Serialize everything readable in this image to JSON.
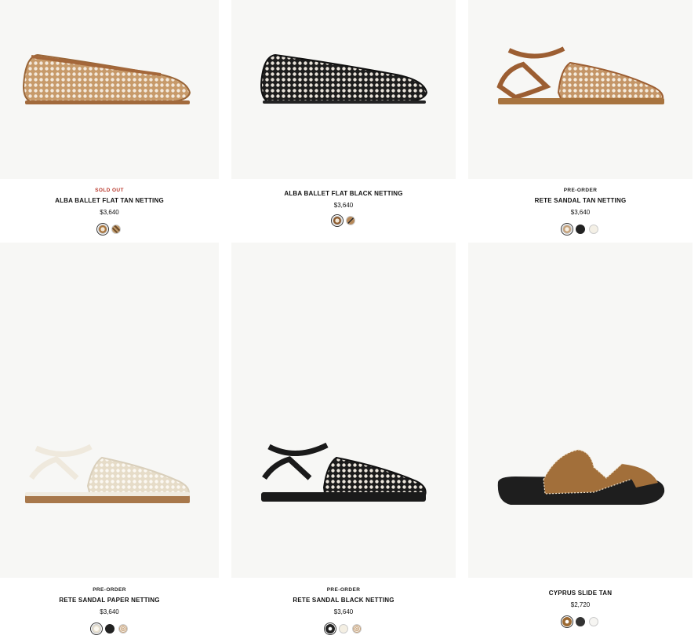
{
  "products": [
    {
      "badge": "SOLD OUT",
      "name": "ALBA BALLET FLAT TAN NETTING",
      "price": "$3,640",
      "swatches": [
        "tan-netting",
        "tan-check"
      ]
    },
    {
      "badge": "",
      "name": "ALBA BALLET FLAT BLACK NETTING",
      "price": "$3,640",
      "swatches": [
        "tan-netting",
        "tan-stripe"
      ]
    },
    {
      "badge": "PRE-ORDER",
      "name": "RETE SANDAL TAN NETTING",
      "price": "$3,640",
      "swatches": [
        "netting-light",
        "black",
        "cream"
      ]
    },
    {
      "badge": "PRE-ORDER",
      "name": "RETE SANDAL PAPER NETTING",
      "price": "$3,640",
      "swatches": [
        "cream",
        "black",
        "netting-tan"
      ]
    },
    {
      "badge": "PRE-ORDER",
      "name": "RETE SANDAL BLACK NETTING",
      "price": "$3,640",
      "swatches": [
        "black",
        "cream",
        "netting-tan"
      ]
    },
    {
      "badge": "",
      "name": "CYPRUS SLIDE TAN",
      "price": "$2,720",
      "swatches": [
        "tan-suede",
        "black",
        "white"
      ]
    }
  ],
  "colors": {
    "sold_out": "#b8362a",
    "image_bg": "#f7f7f5",
    "tan": "#b07a4a",
    "black": "#1c1c1c",
    "cream": "#f3efe6"
  }
}
